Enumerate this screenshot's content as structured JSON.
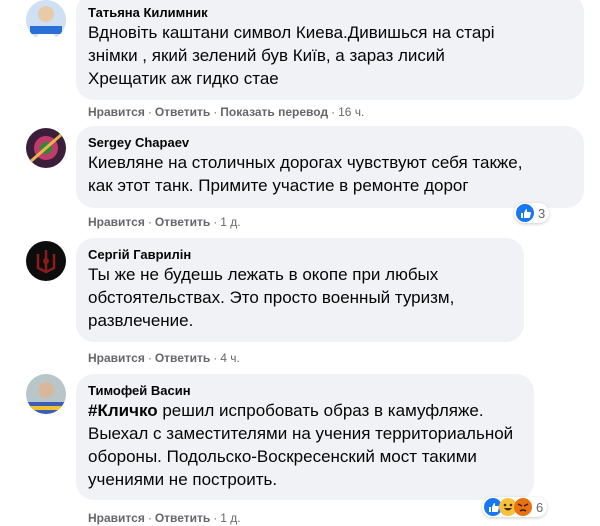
{
  "comments": [
    {
      "author": "Татьяна Килимник",
      "lines": [
        "Вдновіть каштани символ Киева.Дивишься на старі",
        "знімки , який зелений був Київ, а зараз лисий",
        "Хрещатик аж гидко стае"
      ],
      "like": "Нравится",
      "reply": "Ответить",
      "translate": "Показать перевод",
      "time": "16 ч."
    },
    {
      "author": "Sergey Chapaev",
      "lines": [
        "Киевляне на столичных дорогах чувствуют себя также,",
        "как этот танк. Примите участие в ремонте дорог"
      ],
      "like": "Нравится",
      "reply": "Ответить",
      "time": "1 д.",
      "reaction_count": "3"
    },
    {
      "author": "Сергій Гаврилін",
      "lines": [
        "Ты же не будешь лежать в окопе при любых",
        "обстоятельствах. Это просто военный туризм,",
        "развлечение."
      ],
      "like": "Нравится",
      "reply": "Ответить",
      "time": "4 ч."
    },
    {
      "author": "Тимофей Васин",
      "hashtag": "#Кличко",
      "first_line_rest": " решил испробовать образ в камуфляже.",
      "lines": [
        "Выехал с заместителями на учения территориальной",
        "обороны. Подольско-Воскресенский мост такими",
        "учениями не построить."
      ],
      "like": "Нравится",
      "reply": "Ответить",
      "time": "1 д.",
      "reaction_count": "6"
    }
  ],
  "separator": "·",
  "colors": {
    "bubble": "#f0f2f5",
    "meta": "#65676b",
    "like_blue": "#1877f2"
  }
}
